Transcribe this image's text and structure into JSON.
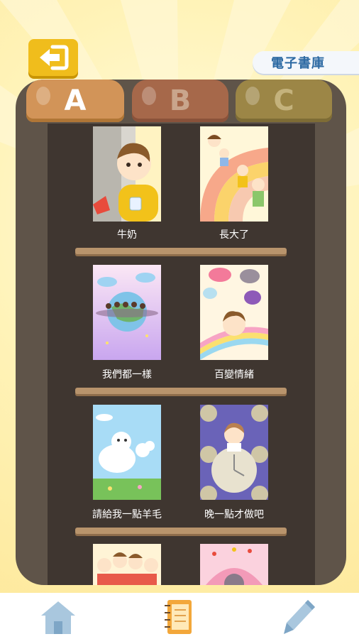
{
  "header": {
    "back_icon": "exit-arrow-icon",
    "library_title": "電子書庫"
  },
  "tabs": [
    {
      "label": "A",
      "selected": true
    },
    {
      "label": "B",
      "selected": false
    },
    {
      "label": "C",
      "selected": false
    }
  ],
  "books": [
    {
      "title": "牛奶"
    },
    {
      "title": "長大了"
    },
    {
      "title": "我們都一樣"
    },
    {
      "title": "百變情緒"
    },
    {
      "title": "請給我一點羊毛"
    },
    {
      "title": "晚一點才做吧"
    }
  ],
  "bottom_nav": [
    {
      "icon": "house-icon"
    },
    {
      "icon": "notebook-icon"
    },
    {
      "icon": "pencil-icon"
    }
  ],
  "colors": {
    "accent": "#f0bd1c",
    "shelf": "#5f5449",
    "title_text": "#2d6aa3"
  }
}
